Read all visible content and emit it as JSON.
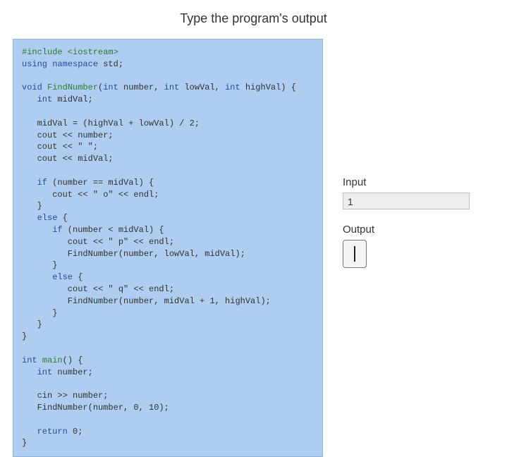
{
  "title": "Type the program's output",
  "code": {
    "lines": [
      {
        "t": "#include <iostream>",
        "cls": "kw-preproc"
      },
      {
        "t": "using namespace std;",
        "span": [
          {
            "txt": "using namespace",
            "cls": "kw-blue"
          },
          {
            "txt": " std;",
            "cls": ""
          }
        ]
      },
      {
        "t": ""
      },
      {
        "span": [
          {
            "txt": "void ",
            "cls": "kw-blue"
          },
          {
            "txt": "FindNumber",
            "cls": "kw-green"
          },
          {
            "txt": "(",
            "cls": ""
          },
          {
            "txt": "int",
            "cls": "kw-blue"
          },
          {
            "txt": " number, ",
            "cls": ""
          },
          {
            "txt": "int",
            "cls": "kw-blue"
          },
          {
            "txt": " lowVal, ",
            "cls": ""
          },
          {
            "txt": "int",
            "cls": "kw-blue"
          },
          {
            "txt": " highVal) {",
            "cls": ""
          }
        ]
      },
      {
        "span": [
          {
            "txt": "   int",
            "cls": "kw-blue"
          },
          {
            "txt": " midVal;",
            "cls": ""
          }
        ]
      },
      {
        "t": ""
      },
      {
        "t": "   midVal = (highVal + lowVal) / 2;"
      },
      {
        "t": "   cout << number;"
      },
      {
        "t": "   cout << \" \";"
      },
      {
        "t": "   cout << midVal;"
      },
      {
        "t": ""
      },
      {
        "span": [
          {
            "txt": "   if",
            "cls": "kw-blue"
          },
          {
            "txt": " (number == midVal) {",
            "cls": ""
          }
        ]
      },
      {
        "t": "      cout << \" o\" << endl;"
      },
      {
        "t": "   }"
      },
      {
        "span": [
          {
            "txt": "   else",
            "cls": "kw-blue"
          },
          {
            "txt": " {",
            "cls": ""
          }
        ]
      },
      {
        "span": [
          {
            "txt": "      if",
            "cls": "kw-blue"
          },
          {
            "txt": " (number < midVal) {",
            "cls": ""
          }
        ]
      },
      {
        "t": "         cout << \" p\" << endl;"
      },
      {
        "t": "         FindNumber(number, lowVal, midVal);"
      },
      {
        "t": "      }"
      },
      {
        "span": [
          {
            "txt": "      else",
            "cls": "kw-blue"
          },
          {
            "txt": " {",
            "cls": ""
          }
        ]
      },
      {
        "t": "         cout << \" q\" << endl;"
      },
      {
        "t": "         FindNumber(number, midVal + 1, highVal);"
      },
      {
        "t": "      }"
      },
      {
        "t": "   }"
      },
      {
        "t": "}"
      },
      {
        "t": ""
      },
      {
        "span": [
          {
            "txt": "int ",
            "cls": "kw-blue"
          },
          {
            "txt": "main",
            "cls": "kw-green"
          },
          {
            "txt": "() {",
            "cls": ""
          }
        ]
      },
      {
        "span": [
          {
            "txt": "   int",
            "cls": "kw-blue"
          },
          {
            "txt": " number;",
            "cls": ""
          }
        ]
      },
      {
        "t": ""
      },
      {
        "t": "   cin >> number;"
      },
      {
        "t": "   FindNumber(number, 0, 10);"
      },
      {
        "t": ""
      },
      {
        "span": [
          {
            "txt": "   return",
            "cls": "kw-blue"
          },
          {
            "txt": " 0;",
            "cls": ""
          }
        ]
      },
      {
        "t": "}"
      }
    ]
  },
  "input": {
    "label": "Input",
    "value": "1"
  },
  "output": {
    "label": "Output",
    "value": ""
  }
}
